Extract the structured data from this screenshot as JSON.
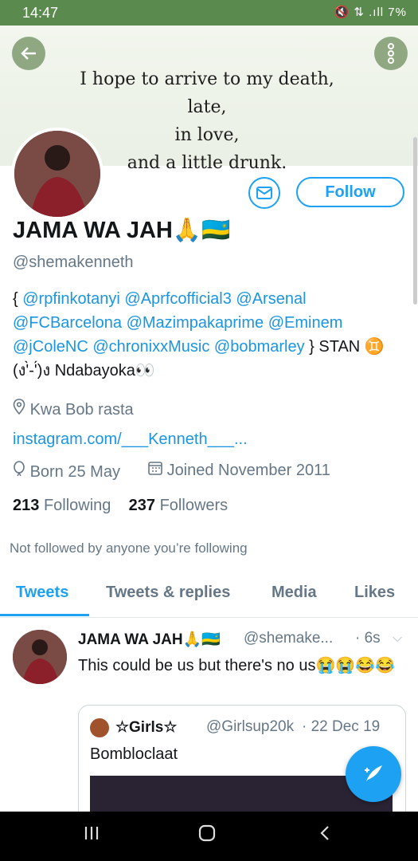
{
  "status_bar": {
    "time": "14:47",
    "indicators": "🔇 ⇅ .ıll 7%"
  },
  "banner": {
    "quote_lines": [
      "I hope to arrive to my death,",
      "late,",
      "in love,",
      "and a little drunk."
    ]
  },
  "profile": {
    "name": "JAMA WA JAH🙏🇷🇼",
    "handle": "@shemakenneth",
    "follow_label": "Follow",
    "bio": {
      "open": "{ ",
      "mentions": [
        "@rpfinkotanyi",
        "@Aprfcofficial3",
        "@Arsenal",
        "@FCBarcelona",
        "@Mazimpakaprime",
        "@Eminem",
        "@jColeNC",
        "@chronixxMusic",
        "@bobmarley"
      ],
      "close": " } STAN",
      "line_end": "♊  (ง'̀-'́)ง   Ndabayoka👀"
    },
    "location": "Kwa Bob rasta",
    "link": "instagram.com/___Kenneth___...",
    "born": "Born 25 May",
    "joined": "Joined November 2011",
    "following_count": "213",
    "following_label": "Following",
    "followers_count": "237",
    "followers_label": "Followers",
    "not_followed": "Not followed by anyone you’re following"
  },
  "tabs": [
    "Tweets",
    "Tweets & replies",
    "Media",
    "Likes"
  ],
  "tweet": {
    "name": "JAMA WA JAH🙏🇷🇼",
    "handle": "@shemake...",
    "time": "· 6s",
    "text": "This could be us but there's no us😭😭😂😂",
    "quoted": {
      "name": "☆Girls☆",
      "handle": "@Girlsup20k",
      "date": "· 22 Dec 19",
      "text": "Bombloclaat"
    }
  },
  "colors": {
    "accent": "#1da1f2",
    "status_bar": "#5b8a4f"
  }
}
